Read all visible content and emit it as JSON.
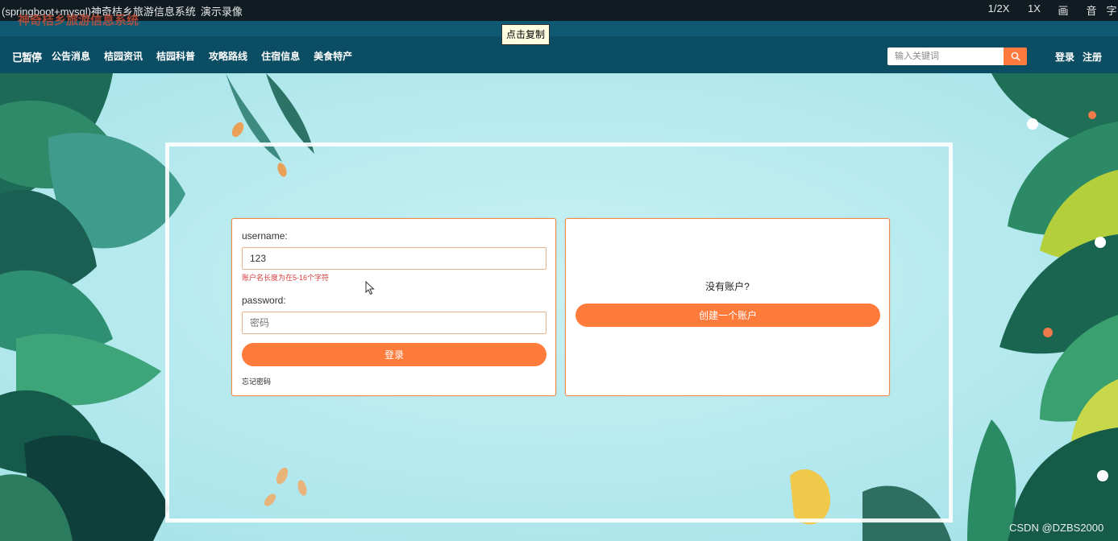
{
  "video_bar": {
    "title": "(springboot+mysql)神奇桔乡旅游信息系统",
    "subtitle": "演示录像",
    "controls": [
      "1/2X",
      "1X",
      "画",
      "音",
      "字"
    ]
  },
  "brand": "神奇桔乡旅游信息系统",
  "copy_tooltip": "点击复制",
  "nav": {
    "paused_label": "已暂停",
    "items": [
      "公告消息",
      "桔园资讯",
      "桔园科普",
      "攻略路线",
      "住宿信息",
      "美食特产"
    ],
    "search_placeholder": "输入关键词",
    "login": "登录",
    "register": "注册"
  },
  "login_form": {
    "username_label": "username:",
    "username_value": "123",
    "username_error": "账户名长度为在5-16个字符",
    "password_label": "password:",
    "password_placeholder": "密码",
    "submit": "登录",
    "forgot": "忘记密码"
  },
  "register_card": {
    "prompt": "没有账户?",
    "button": "创建一个账户"
  },
  "watermark": "CSDN @DZBS2000",
  "colors": {
    "accent": "#ff7b3c",
    "nav_bg": "#0b4e64",
    "error": "#d43c3c"
  }
}
